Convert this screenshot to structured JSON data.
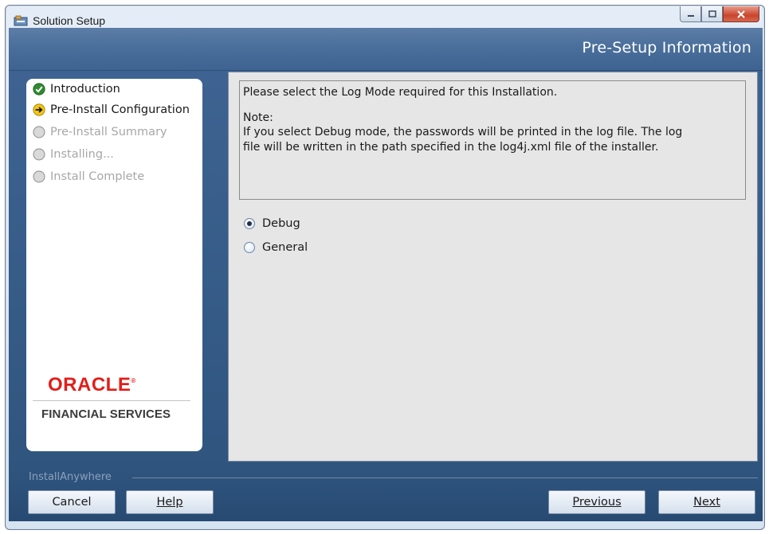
{
  "window": {
    "title": "Solution Setup",
    "icon": "installer-app-icon"
  },
  "header": {
    "title": "Pre-Setup Information"
  },
  "steps": [
    {
      "label": "Introduction",
      "state": "done",
      "icon": "check-circle-icon"
    },
    {
      "label": "Pre-Install Configuration",
      "state": "current",
      "icon": "arrow-right-circle-icon"
    },
    {
      "label": "Pre-Install Summary",
      "state": "pending",
      "icon": "empty-circle-icon"
    },
    {
      "label": "Installing...",
      "state": "pending",
      "icon": "empty-circle-icon"
    },
    {
      "label": "Install Complete",
      "state": "pending",
      "icon": "empty-circle-icon"
    }
  ],
  "branding": {
    "logo_text": "ORACLE",
    "subtitle": "FINANCIAL SERVICES"
  },
  "content": {
    "prompt": "Please select the Log Mode required for this Installation.",
    "note_heading": "Note:",
    "note_line1": "If you select Debug mode, the passwords will be printed in the log file. The log",
    "note_line2": "file will be written in the path specified in the log4j.xml file of the installer."
  },
  "log_mode": {
    "options": [
      {
        "label": "Debug",
        "selected": true
      },
      {
        "label": "General",
        "selected": false
      }
    ]
  },
  "footer": {
    "brand_label": "InstallAnywhere",
    "cancel_label": "Cancel",
    "help_label": "Help",
    "previous_label": "Previous",
    "next_label": "Next"
  },
  "colors": {
    "header_band": "#4a6f9b",
    "accent_red": "#e31d1a",
    "content_bg": "#e6e6e6"
  }
}
